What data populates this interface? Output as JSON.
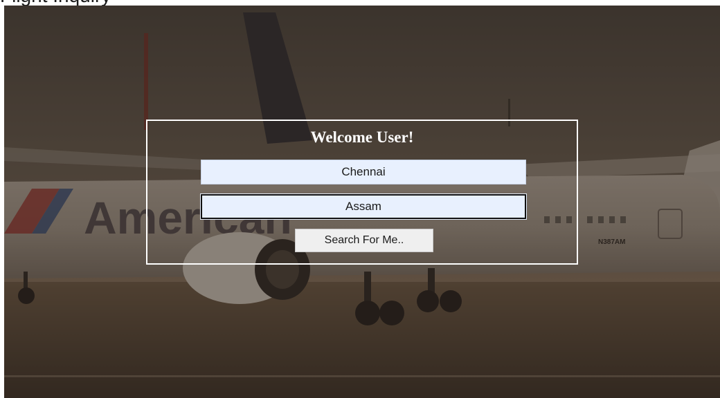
{
  "header": {
    "title": "Flight Inquiry"
  },
  "background": {
    "scene": "airplane-on-tarmac",
    "airline_text": "American",
    "tail_number": "N387AM",
    "overlay_color": "#2a221b"
  },
  "form": {
    "title": "Welcome User!",
    "from_value": "Chennai",
    "to_value": "Assam",
    "search_label": "Search For Me.."
  },
  "colors": {
    "card_border": "#ffffff",
    "input_bg": "#e8f0fe",
    "button_bg": "#efefef"
  }
}
